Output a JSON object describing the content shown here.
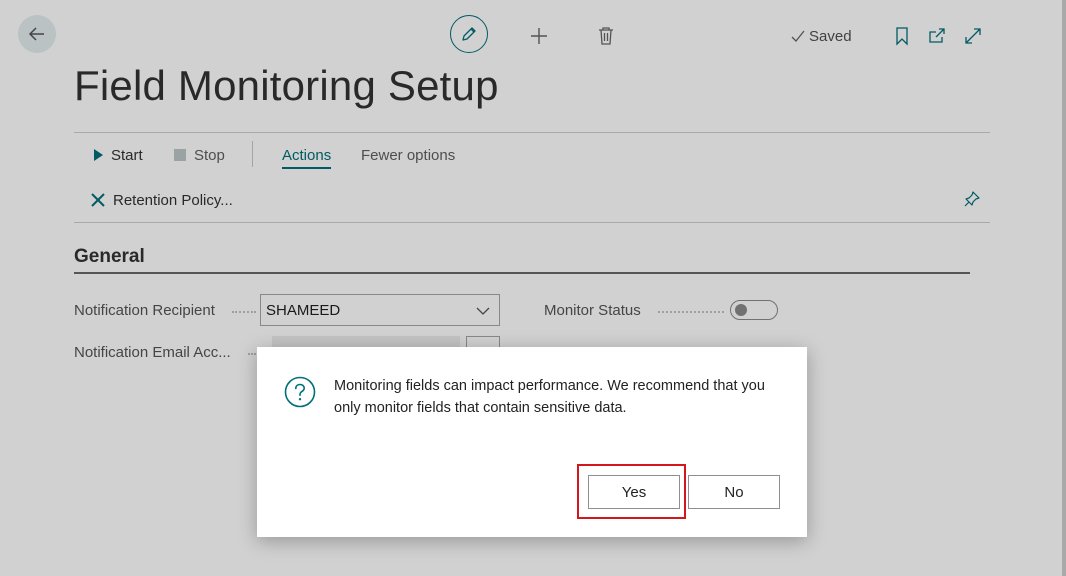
{
  "app": {
    "title": "Field Monitoring Setup",
    "status": "Saved",
    "accent_color": "#00707a",
    "icons": {
      "back": "arrow-left-icon",
      "edit": "pencil-icon",
      "new": "plus-icon",
      "delete": "trash-icon",
      "saved": "checkmark-icon",
      "bookmark": "bookmark-icon",
      "open_new_window": "open-in-new-window-icon",
      "expand": "expand-icon"
    }
  },
  "actions": {
    "start": "Start",
    "stop": "Stop",
    "actions_tab": "Actions",
    "fewer_options": "Fewer options",
    "retention_policy": "Retention Policy..."
  },
  "general": {
    "title": "General",
    "notification_recipient": {
      "label": "Notification Recipient",
      "value": "SHAMEED"
    },
    "notification_email_account": {
      "label": "Notification Email Acc..."
    },
    "monitor_status": {
      "label": "Monitor Status",
      "value": false
    }
  },
  "dialog": {
    "message": "Monitoring fields can impact performance. We recommend that you only monitor fields that contain sensitive data.",
    "yes": "Yes",
    "no": "No",
    "highlight_color": "#d4161d"
  }
}
